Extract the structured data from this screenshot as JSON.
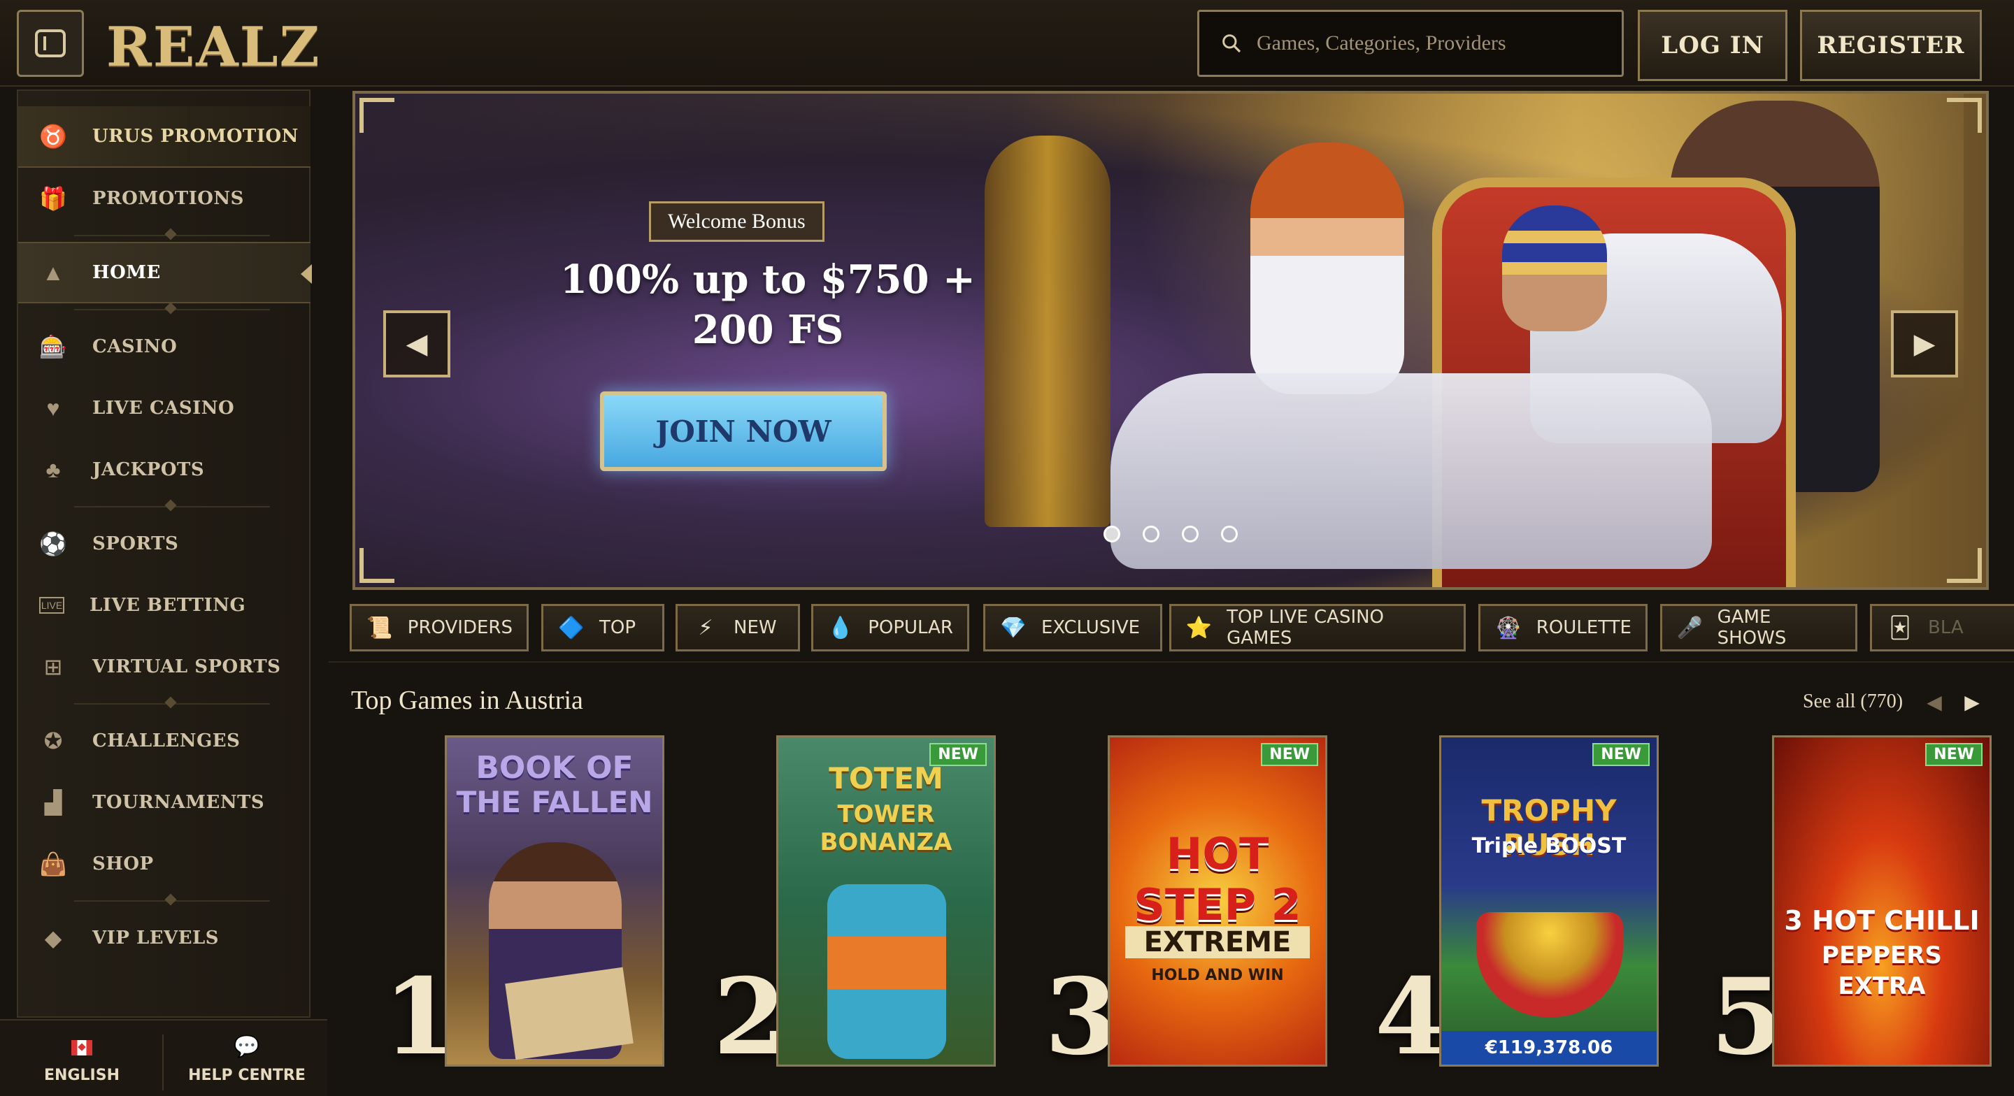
{
  "header": {
    "logo": "REALZ",
    "search_placeholder": "Games, Categories, Providers",
    "login_label": "LOG IN",
    "register_label": "REGISTER"
  },
  "sidebar": {
    "items": [
      {
        "label": "URUS PROMOTION",
        "icon": "bull-icon"
      },
      {
        "label": "PROMOTIONS",
        "icon": "gift-icon"
      },
      {
        "label": "HOME",
        "icon": "pyramid-icon"
      },
      {
        "label": "CASINO",
        "icon": "slot-machine-icon"
      },
      {
        "label": "LIVE CASINO",
        "icon": "card-icon"
      },
      {
        "label": "JACKPOTS",
        "icon": "clover-icon"
      },
      {
        "label": "SPORTS",
        "icon": "ball-icon"
      },
      {
        "label": "LIVE BETTING",
        "icon": "live-icon"
      },
      {
        "label": "VIRTUAL SPORTS",
        "icon": "virtual-icon"
      },
      {
        "label": "CHALLENGES",
        "icon": "medal-icon"
      },
      {
        "label": "TOURNAMENTS",
        "icon": "podium-icon"
      },
      {
        "label": "SHOP",
        "icon": "bag-icon"
      },
      {
        "label": "VIP LEVELS",
        "icon": "diamond-icon"
      }
    ],
    "footer": {
      "language_label": "ENGLISH",
      "help_label": "HELP CENTRE"
    }
  },
  "banner": {
    "badge": "Welcome Bonus",
    "title_line1": "100% up to $750 +",
    "title_line2": "200 FS",
    "cta": "JOIN NOW",
    "slides": 4,
    "active_slide": 1
  },
  "categories": [
    {
      "label": "PROVIDERS",
      "icon": "scroll-icon"
    },
    {
      "label": "TOP",
      "icon": "pyramid-icon"
    },
    {
      "label": "NEW",
      "icon": "lightning-icon"
    },
    {
      "label": "POPULAR",
      "icon": "drop-icon"
    },
    {
      "label": "EXCLUSIVE",
      "icon": "gem-icon"
    },
    {
      "label": "TOP LIVE CASINO GAMES",
      "icon": "star-icon"
    },
    {
      "label": "ROULETTE",
      "icon": "roulette-icon"
    },
    {
      "label": "GAME SHOWS",
      "icon": "microphone-icon"
    },
    {
      "label": "BLA",
      "icon": "card-icon"
    }
  ],
  "top_games": {
    "title": "Top Games in Austria",
    "see_all": "See all (770)",
    "games": [
      {
        "rank": "1",
        "title_line1": "BOOK OF",
        "title_line2": "THE FALLEN",
        "new": "",
        "jackpot": ""
      },
      {
        "rank": "2",
        "title_line1": "TOTEM",
        "title_line2": "TOWER BONANZA",
        "new": "NEW",
        "jackpot": ""
      },
      {
        "rank": "3",
        "title_line1": "HOT STEP 2",
        "title_line2": "EXTREME",
        "subtitle": "HOLD AND WIN",
        "new": "NEW",
        "jackpot": ""
      },
      {
        "rank": "4",
        "title_line1": "TROPHY RUSH",
        "title_line2": "Triple BOOST",
        "new": "NEW",
        "jackpot": "€119,378.06"
      },
      {
        "rank": "5",
        "title_line1": "3 HOT CHILLI",
        "title_line2": "PEPPERS EXTRA",
        "new": "NEW",
        "jackpot": ""
      }
    ]
  }
}
